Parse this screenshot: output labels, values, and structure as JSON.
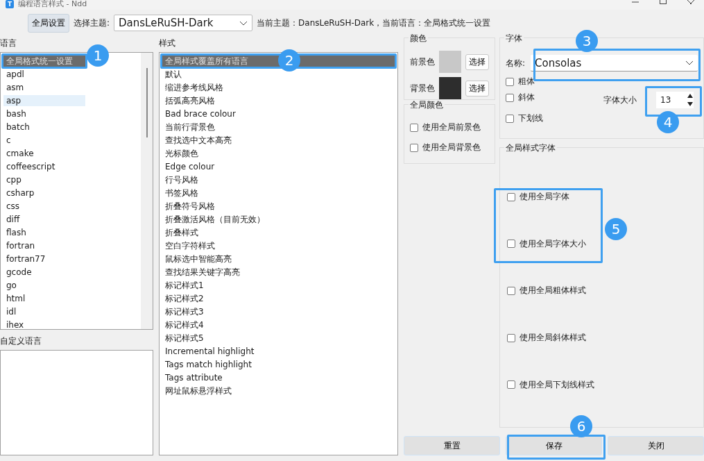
{
  "window": {
    "app_icon": "T",
    "title": "编程语言样式 - Ndd"
  },
  "toolbar": {
    "global_button": "全局设置",
    "theme_label": "选择主题:",
    "theme_value": "DansLeRuSH-Dark",
    "status": "当前主题：DansLeRuSH-Dark，当前语言：全局格式统一设置"
  },
  "languages": {
    "label": "语言",
    "items": [
      {
        "name": "全局格式统一设置",
        "selected": true,
        "hovered": false
      },
      {
        "name": "apdl",
        "selected": false,
        "hovered": false
      },
      {
        "name": "asm",
        "selected": false,
        "hovered": false
      },
      {
        "name": "asp",
        "selected": false,
        "hovered": true
      },
      {
        "name": "bash",
        "selected": false,
        "hovered": false
      },
      {
        "name": "batch",
        "selected": false,
        "hovered": false
      },
      {
        "name": "c",
        "selected": false,
        "hovered": false
      },
      {
        "name": "cmake",
        "selected": false,
        "hovered": false
      },
      {
        "name": "coffeescript",
        "selected": false,
        "hovered": false
      },
      {
        "name": "cpp",
        "selected": false,
        "hovered": false
      },
      {
        "name": "csharp",
        "selected": false,
        "hovered": false
      },
      {
        "name": "css",
        "selected": false,
        "hovered": false
      },
      {
        "name": "diff",
        "selected": false,
        "hovered": false
      },
      {
        "name": "flash",
        "selected": false,
        "hovered": false
      },
      {
        "name": "fortran",
        "selected": false,
        "hovered": false
      },
      {
        "name": "fortran77",
        "selected": false,
        "hovered": false
      },
      {
        "name": "gcode",
        "selected": false,
        "hovered": false
      },
      {
        "name": "go",
        "selected": false,
        "hovered": false
      },
      {
        "name": "html",
        "selected": false,
        "hovered": false
      },
      {
        "name": "idl",
        "selected": false,
        "hovered": false
      },
      {
        "name": "ihex",
        "selected": false,
        "hovered": false
      }
    ]
  },
  "custom_languages": {
    "label": "自定义语言"
  },
  "styles": {
    "label": "样式",
    "items": [
      {
        "name": "全局样式覆盖所有语言",
        "selected": true
      },
      {
        "name": "默认",
        "selected": false
      },
      {
        "name": "缩进参考线风格",
        "selected": false
      },
      {
        "name": "括弧高亮风格",
        "selected": false
      },
      {
        "name": "Bad brace colour",
        "selected": false
      },
      {
        "name": "当前行背景色",
        "selected": false
      },
      {
        "name": "查找选中文本高亮",
        "selected": false
      },
      {
        "name": "光标颜色",
        "selected": false
      },
      {
        "name": "Edge colour",
        "selected": false
      },
      {
        "name": "行号风格",
        "selected": false
      },
      {
        "name": "书签风格",
        "selected": false
      },
      {
        "name": "折叠符号风格",
        "selected": false
      },
      {
        "name": "折叠激活风格（目前无效）",
        "selected": false
      },
      {
        "name": "折叠样式",
        "selected": false
      },
      {
        "name": "空白字符样式",
        "selected": false
      },
      {
        "name": "鼠标选中智能高亮",
        "selected": false
      },
      {
        "name": "查找结果关键字高亮",
        "selected": false
      },
      {
        "name": "标记样式1",
        "selected": false
      },
      {
        "name": "标记样式2",
        "selected": false
      },
      {
        "name": "标记样式3",
        "selected": false
      },
      {
        "name": "标记样式4",
        "selected": false
      },
      {
        "name": "标记样式5",
        "selected": false
      },
      {
        "name": "Incremental highlight",
        "selected": false
      },
      {
        "name": "Tags match highlight",
        "selected": false
      },
      {
        "name": "Tags attribute",
        "selected": false
      },
      {
        "name": "网址鼠标悬浮样式",
        "selected": false
      }
    ]
  },
  "colors": {
    "title": "颜色",
    "rows": [
      {
        "label": "前景色",
        "color": "#c8c8c8",
        "button": "选择"
      },
      {
        "label": "背景色",
        "color": "#2d2d2d",
        "button": "选择"
      }
    ]
  },
  "global_colors": {
    "title": "全局颜色",
    "options": [
      {
        "label": "使用全局前景色",
        "checked": false
      },
      {
        "label": "使用全局背景色",
        "checked": false
      }
    ]
  },
  "font": {
    "title": "字体",
    "name_label": "名称:",
    "name_value": "Consolas",
    "options": [
      {
        "label": "粗体",
        "checked": false
      },
      {
        "label": "斜体",
        "checked": false
      },
      {
        "label": "下划线",
        "checked": false
      }
    ],
    "size_label": "字体大小",
    "size_value": "13"
  },
  "global_font": {
    "title": "全局样式字体",
    "options": [
      {
        "label": "使用全局字体",
        "checked": false
      },
      {
        "label": "使用全局字体大小",
        "checked": false
      },
      {
        "label": "使用全局粗体样式",
        "checked": false
      },
      {
        "label": "使用全局斜体样式",
        "checked": false
      },
      {
        "label": "使用全局下划线样式",
        "checked": false
      }
    ]
  },
  "buttons": [
    {
      "label": "重置"
    },
    {
      "label": "保存"
    },
    {
      "label": "关闭"
    }
  ],
  "annotations": [
    {
      "label": "1"
    },
    {
      "label": "2"
    },
    {
      "label": "3"
    },
    {
      "label": "4"
    },
    {
      "label": "5"
    },
    {
      "label": "6"
    }
  ]
}
